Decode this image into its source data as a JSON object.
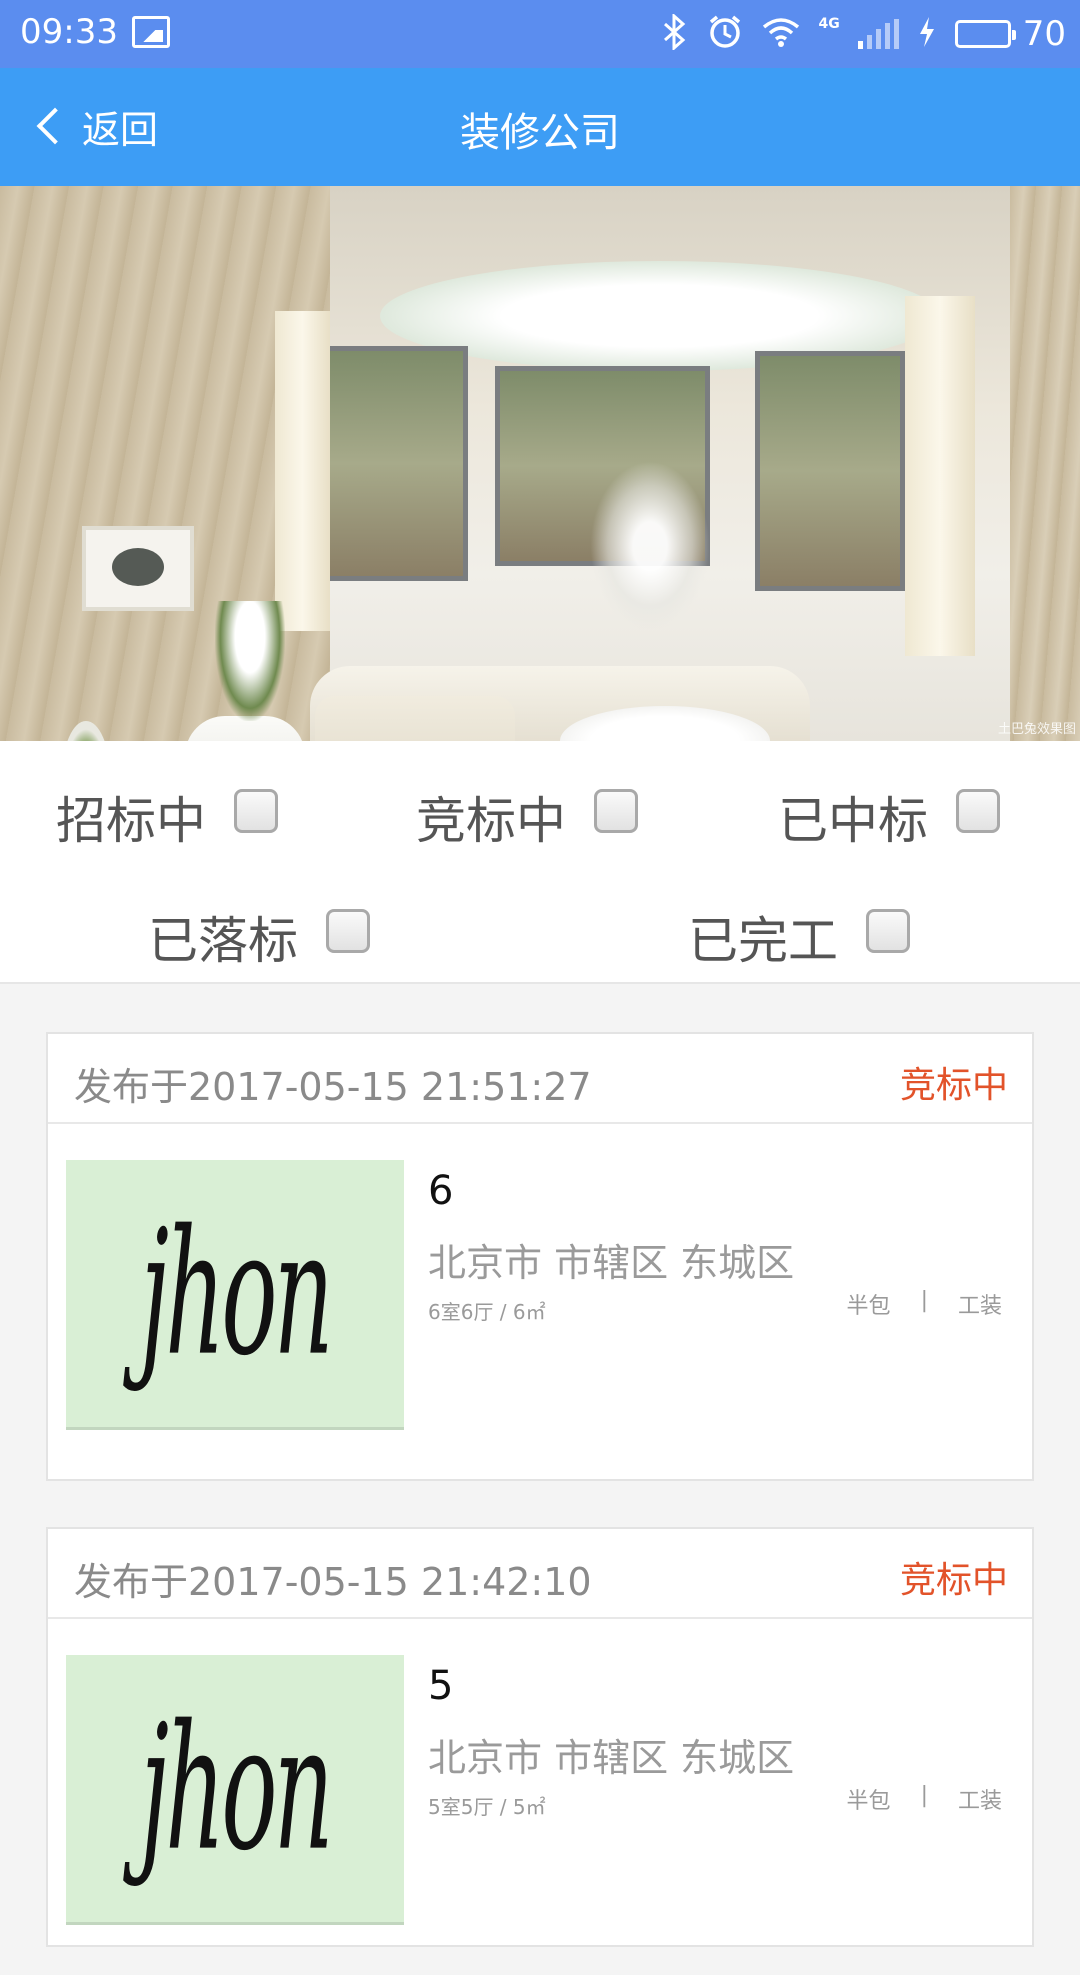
{
  "status_bar": {
    "time": "09:33",
    "battery": "70",
    "network": "4G",
    "icons": [
      "gallery-icon",
      "bluetooth-icon",
      "alarm-icon",
      "wifi-icon",
      "signal-icon",
      "charging-icon",
      "battery-icon"
    ]
  },
  "title_bar": {
    "back_label": "返回",
    "title": "装修公司"
  },
  "banner": {
    "watermark": "土巴兔效果图"
  },
  "filters": {
    "options": [
      {
        "label": "招标中",
        "checked": false
      },
      {
        "label": "竞标中",
        "checked": false
      },
      {
        "label": "已中标",
        "checked": false
      },
      {
        "label": "已落标",
        "checked": false
      },
      {
        "label": "已完工",
        "checked": false
      }
    ]
  },
  "listings": [
    {
      "published": "发布于2017-05-15 21:51:27",
      "status": "竞标中",
      "thumbnail_text": "jhon",
      "title": "6",
      "address": "北京市 市辖区 东城区",
      "rooms": "6室6厅 / 6㎡",
      "package": "半包",
      "separator": "|",
      "type": "工装"
    },
    {
      "published": "发布于2017-05-15 21:42:10",
      "status": "竞标中",
      "thumbnail_text": "jhon",
      "title": "5",
      "address": "北京市 市辖区 东城区",
      "rooms": "5室5厅 / 5㎡",
      "package": "半包",
      "separator": "|",
      "type": "工装"
    }
  ],
  "colors": {
    "status_bar": "#5b8def",
    "title_bar": "#3d9df5",
    "status_accent": "#e2532a"
  }
}
